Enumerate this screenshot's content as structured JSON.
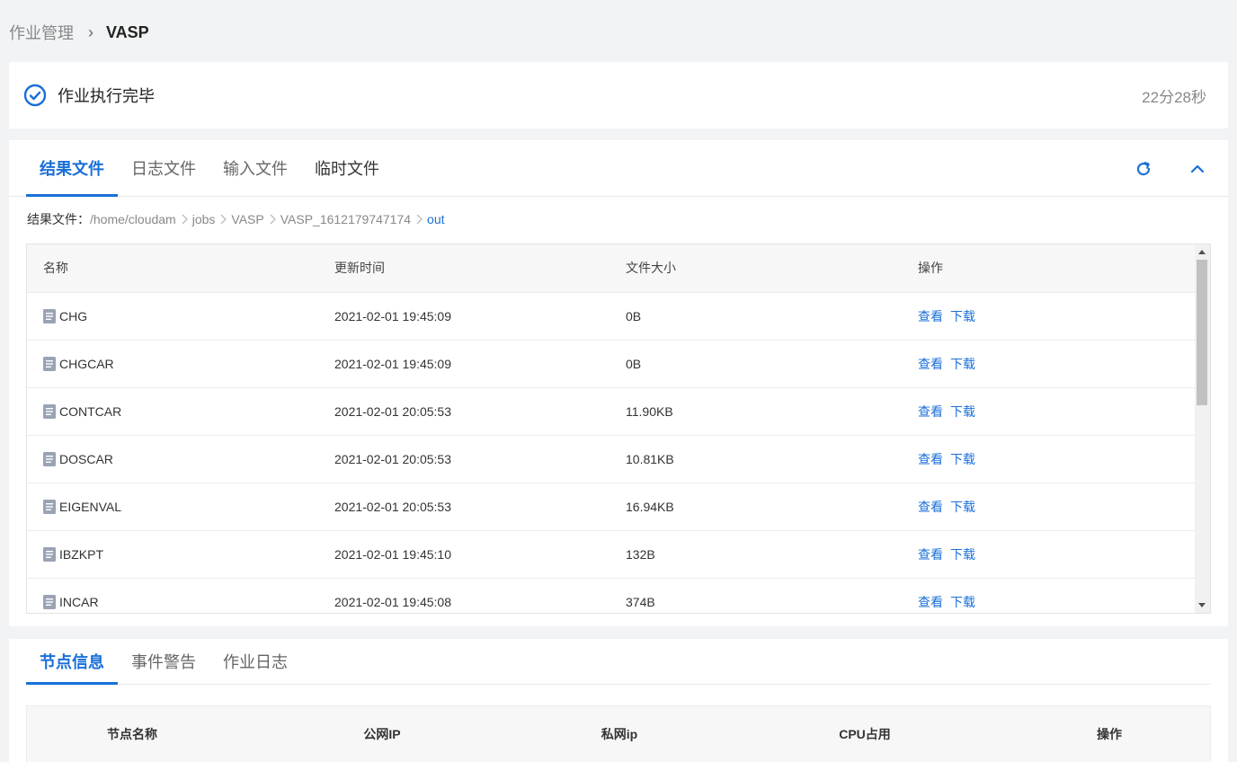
{
  "breadcrumb": {
    "parent": "作业管理",
    "current": "VASP"
  },
  "status": {
    "text": "作业执行完毕",
    "duration": "22分28秒"
  },
  "file_tabs": [
    "结果文件",
    "日志文件",
    "输入文件",
    "临时文件"
  ],
  "path": {
    "label": "结果文件：",
    "segments": [
      "/home/cloudam",
      "jobs",
      "VASP",
      "VASP_1612179747174",
      "out"
    ]
  },
  "file_table": {
    "headers": [
      "名称",
      "更新时间",
      "文件大小",
      "操作"
    ],
    "view_label": "查看",
    "download_label": "下载",
    "rows": [
      {
        "name": "CHG",
        "time": "2021-02-01 19:45:09",
        "size": "0B"
      },
      {
        "name": "CHGCAR",
        "time": "2021-02-01 19:45:09",
        "size": "0B"
      },
      {
        "name": "CONTCAR",
        "time": "2021-02-01 20:05:53",
        "size": "11.90KB"
      },
      {
        "name": "DOSCAR",
        "time": "2021-02-01 20:05:53",
        "size": "10.81KB"
      },
      {
        "name": "EIGENVAL",
        "time": "2021-02-01 20:05:53",
        "size": "16.94KB"
      },
      {
        "name": "IBZKPT",
        "time": "2021-02-01 19:45:10",
        "size": "132B"
      },
      {
        "name": "INCAR",
        "time": "2021-02-01 19:45:08",
        "size": "374B"
      }
    ]
  },
  "node_tabs": [
    "节点信息",
    "事件警告",
    "作业日志"
  ],
  "node_table": {
    "headers": [
      "节点名称",
      "公网IP",
      "私网ip",
      "CPU占用",
      "操作"
    ]
  },
  "colors": {
    "accent": "#1a6fd8",
    "background": "#f2f3f5"
  }
}
